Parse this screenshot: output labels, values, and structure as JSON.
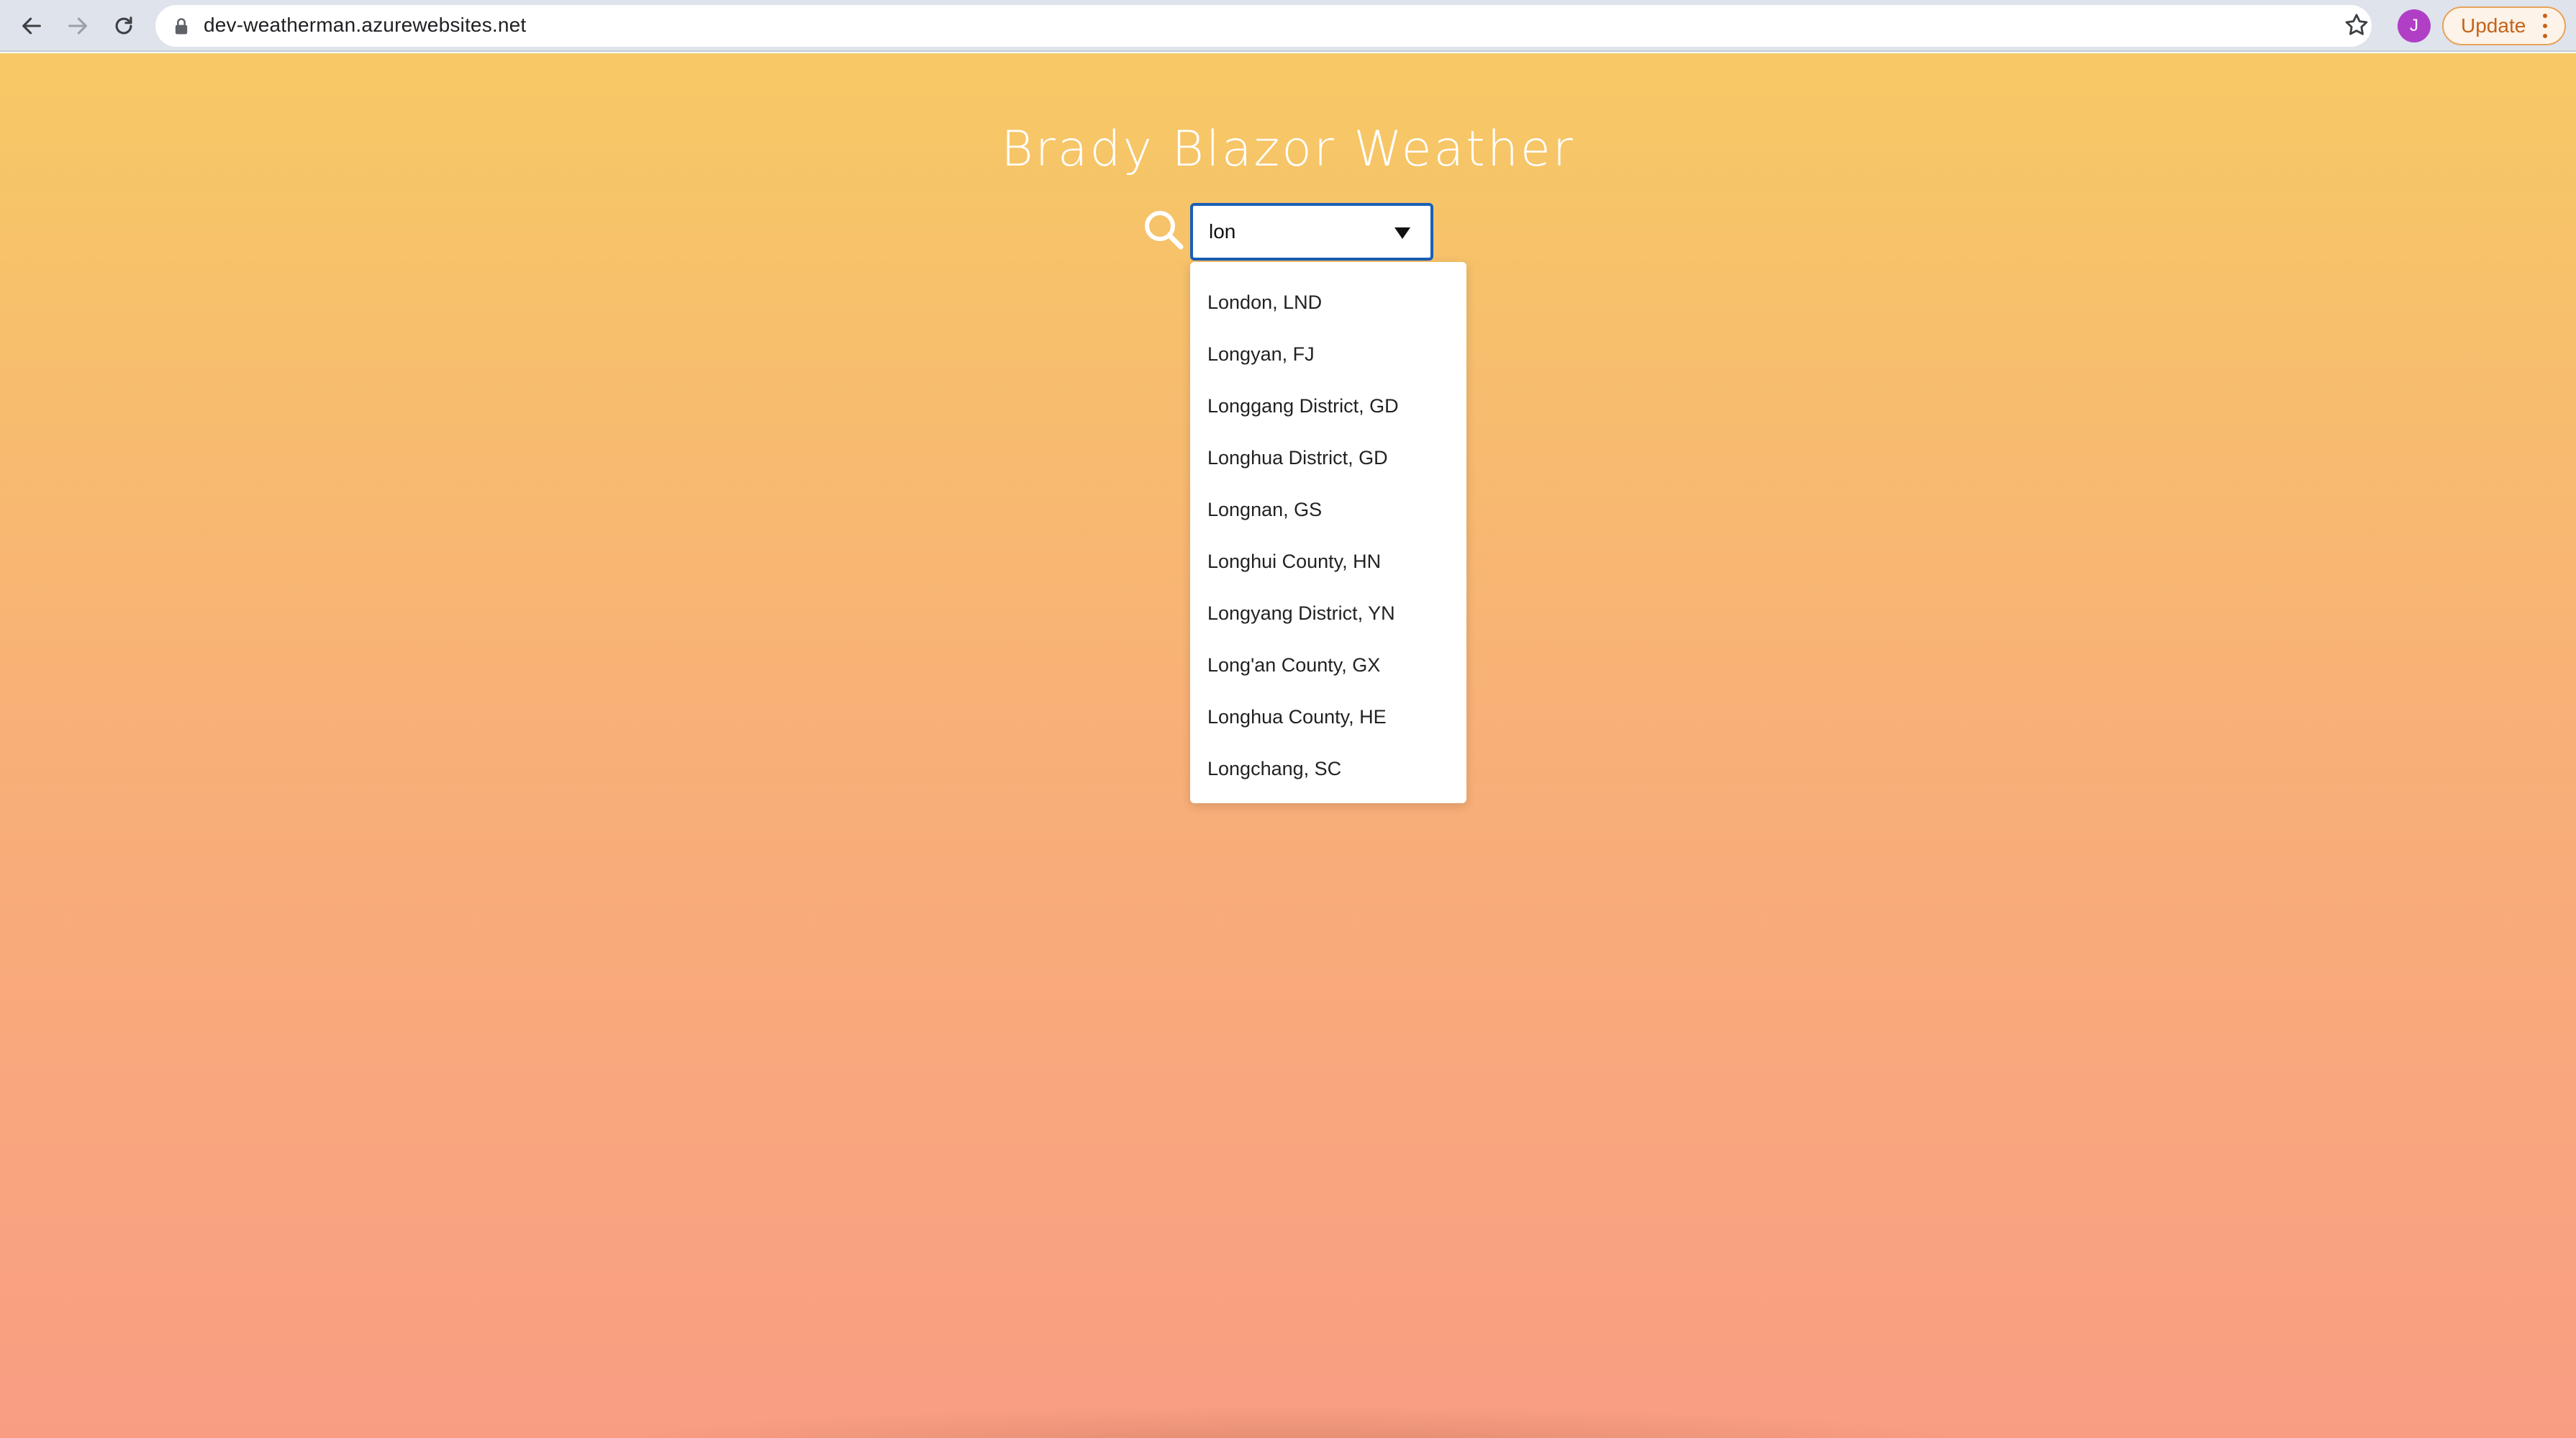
{
  "browser": {
    "url": "dev-weatherman.azurewebsites.net",
    "profile_initial": "J",
    "update_label": "Update",
    "icons": [
      "back-arrow-icon",
      "forward-arrow-icon",
      "reload-icon",
      "lock-icon",
      "star-icon",
      "kebab-menu-icon"
    ]
  },
  "page": {
    "title": "Brady Blazor Weather",
    "search": {
      "value": "lon",
      "icon": "search-icon"
    },
    "suggestions": [
      "London, LND",
      "Longyan, FJ",
      "Longgang District, GD",
      "Longhua District, GD",
      "Longnan, GS",
      "Longhui County, HN",
      "Longyang District, YN",
      "Long'an County, GX",
      "Longhua County, HE",
      "Longchang, SC"
    ]
  },
  "colors": {
    "gradient_top": "#f6c965",
    "gradient_bottom": "#f99d82",
    "focus_border": "#1a5fb4",
    "avatar": "#b03fc6",
    "update_accent": "#c5621a"
  }
}
